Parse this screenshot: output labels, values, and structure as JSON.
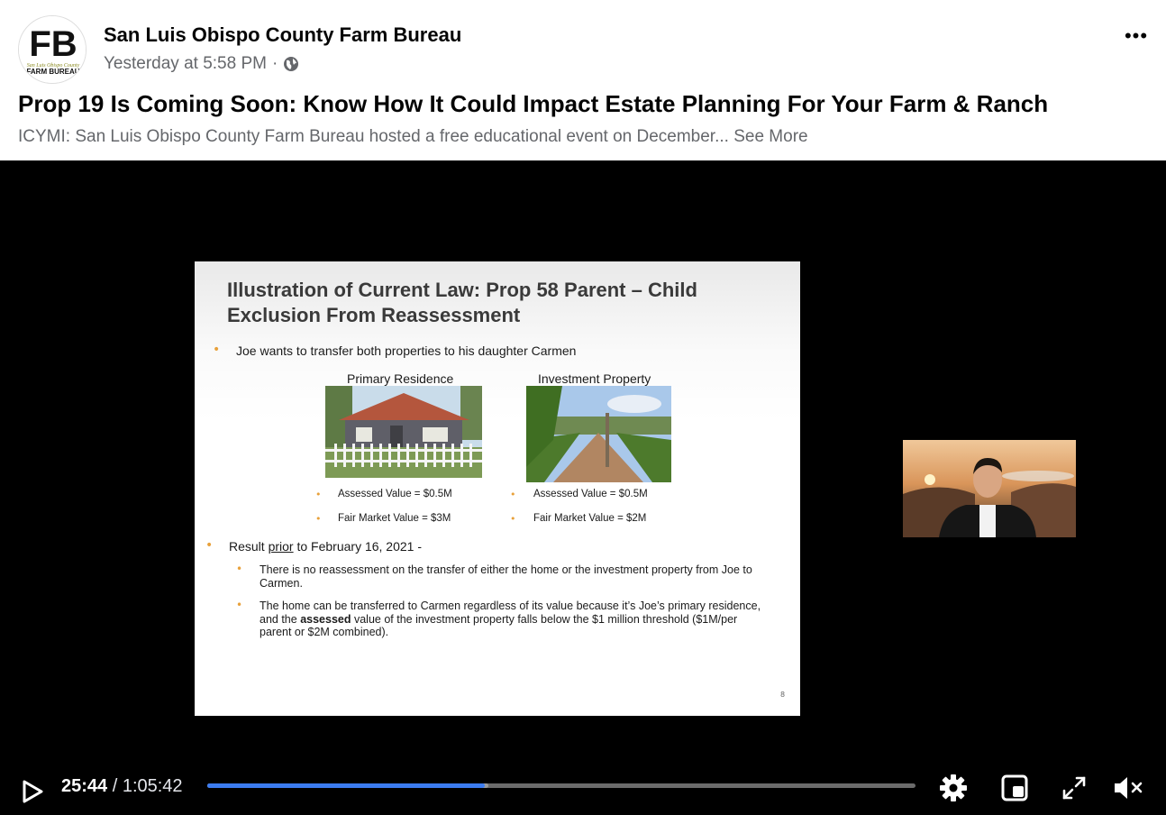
{
  "post": {
    "page_name": "San Luis Obispo County Farm Bureau",
    "timestamp": "Yesterday at 5:58 PM",
    "separator": "·",
    "title": "Prop 19 Is Coming Soon: Know How It Could Impact Estate Planning For Your Farm & Ranch",
    "description": "ICYMI: San Luis Obispo County Farm Bureau hosted a free educational event on December...",
    "see_more": "See More",
    "more_label": "•••",
    "avatar_text": "FB",
    "avatar_subtext": "FARM BUREAU",
    "avatar_county": "San Luis Obispo County"
  },
  "slide": {
    "title_line1": "Illustration of Current Law: Prop 58 Parent – Child",
    "title_line2": "Exclusion From Reassessment",
    "bullet1": "Joe wants to transfer both properties to his daughter Carmen",
    "col1_heading": "Primary Residence",
    "col2_heading": "Investment Property",
    "col1_assessed": "Assessed Value = $0.5M",
    "col1_fmv": "Fair Market Value = $3M",
    "col2_assessed": "Assessed Value = $0.5M",
    "col2_fmv": "Fair Market Value = $2M",
    "result_prefix": "Result ",
    "result_prior": "prior",
    "result_suffix": " to February 16, 2021 -",
    "sub1": "There is no reassessment on the transfer of either the home or the investment property from Joe to Carmen.",
    "sub2_a": "The home can be transferred to Carmen regardless of its value because it’s Joe’s primary residence, and the ",
    "sub2_bold": "assessed",
    "sub2_b": " value of the investment property falls below the $1 million threshold ($1M/per parent or $2M combined).",
    "page_number": "8"
  },
  "player": {
    "current_time": "25:44",
    "separator": " / ",
    "duration": "1:05:42",
    "progress": 0.3915,
    "buffered": 0.3975,
    "colors": {
      "progress": "#3c7cf0",
      "track": "#6b6b6b"
    },
    "icons": [
      "play-icon",
      "settings-gear-icon",
      "picture-in-picture-icon",
      "fullscreen-icon",
      "volume-muted-icon"
    ]
  }
}
